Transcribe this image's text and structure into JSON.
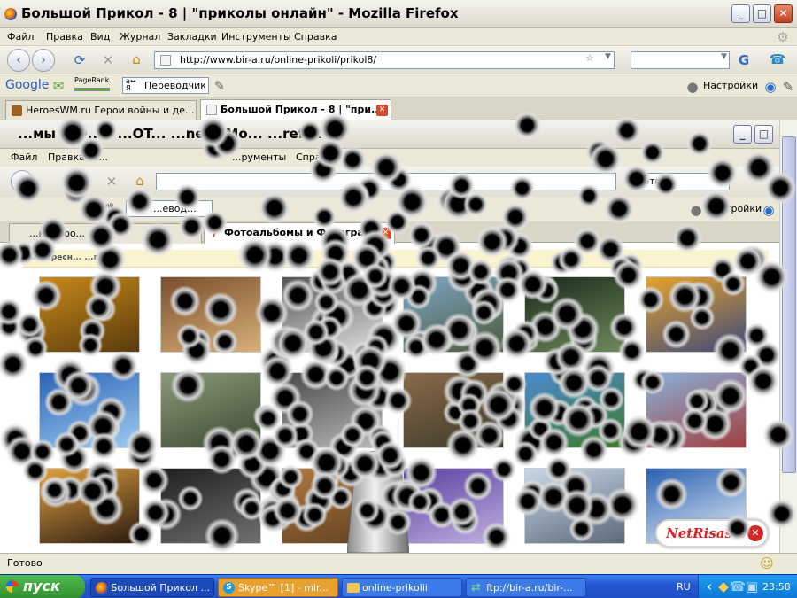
{
  "window": {
    "title": "Большой Прикол - 8 | \"приколы онлайн\" - Mozilla Firefox",
    "controls": [
      "_",
      "□",
      "✕"
    ]
  },
  "menu": [
    "Файл",
    "Правка",
    "Вид",
    "Журнал",
    "Закладки",
    "Инструменты",
    "Справка"
  ],
  "nav": {
    "url": "http://www.bir-a.ru/online-prikoli/prikol8/",
    "search_engine": "G"
  },
  "gbar": {
    "google": "Google",
    "pagerank": "PageRank",
    "translator": "Переводчик",
    "settings": "Настройки"
  },
  "tabs": [
    {
      "label": "HeroesWM.ru Герои войны и де...",
      "active": false
    },
    {
      "label": "Большой Прикол - 8 | \"при...",
      "active": true
    }
  ],
  "inner": {
    "title": "...мы и Ф... - ...OT... ...net - Mo... ...refox",
    "menu": [
      "Файл",
      "Правка",
      "В...",
      "...рументы",
      "Справка"
    ],
    "search_value": "фото",
    "bookmark_partial": "...eRank",
    "translator_partial": "...евод...",
    "settings": "Настройки",
    "tabs": [
      {
        "label": "...к в Goo...",
        "active": false
      },
      {
        "label": "Фотоальбомы и Фотографи...",
        "active": true
      }
    ],
    "strip_text": "интересн... ...гра..."
  },
  "photos": [
    {
      "c1": "#c7891a",
      "c2": "#5a3b0c"
    },
    {
      "c1": "#7a4e2c",
      "c2": "#d8b07a"
    },
    {
      "c1": "#555555",
      "c2": "#e0e0e0"
    },
    {
      "c1": "#7fa6c9",
      "c2": "#4a5a3a"
    },
    {
      "c1": "#1a2a1a",
      "c2": "#6e8a5c"
    },
    {
      "c1": "#e6a22c",
      "c2": "#3e4a7c"
    },
    {
      "c1": "#2a64b8",
      "c2": "#9ecbf0"
    },
    {
      "c1": "#8a9a7a",
      "c2": "#3e4a32"
    },
    {
      "c1": "#4a4a4a",
      "c2": "#b8b8b8"
    },
    {
      "c1": "#8a6a4a",
      "c2": "#3a3a2a"
    },
    {
      "c1": "#4a8ad0",
      "c2": "#3f7a2a"
    },
    {
      "c1": "#8ab0d8",
      "c2": "#a04040"
    },
    {
      "c1": "#e0a040",
      "c2": "#2a1a10"
    },
    {
      "c1": "#202020",
      "c2": "#707070"
    },
    {
      "c1": "#b07840",
      "c2": "#604020"
    },
    {
      "c1": "#5a40a0",
      "c2": "#c0b0e0"
    },
    {
      "c1": "#c8d8e8",
      "c2": "#5a6a7a"
    },
    {
      "c1": "#2a60b0",
      "c2": "#e8f0f8"
    }
  ],
  "logo": {
    "text": "NetRisaser"
  },
  "status": {
    "text": "Готово"
  },
  "taskbar": {
    "start": "пуск",
    "items": [
      "Большой Прикол ...",
      "Skype™ [1] - mir...",
      "online-prikolii",
      "ftp://bir-a.ru/bir-..."
    ],
    "lang": "RU",
    "time": "23:58"
  },
  "colors": {
    "xp_blue": "#2458d3",
    "start_green": "#3a9d3a",
    "close_red": "#d64a2c"
  }
}
